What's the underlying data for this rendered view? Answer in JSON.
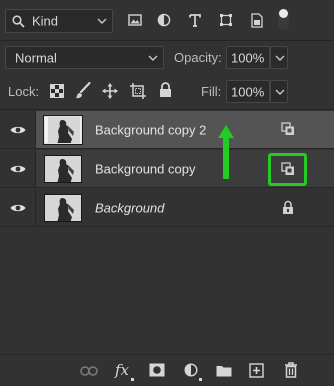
{
  "filter": {
    "kind_label": "Kind"
  },
  "filter_icons": [
    "image-filter-icon",
    "adjustment-filter-icon",
    "type-filter-icon",
    "shape-filter-icon",
    "smart-object-filter-icon",
    "filter-toggle-icon"
  ],
  "blend": {
    "mode": "Normal",
    "opacity_label": "Opacity:",
    "opacity_value": "100%"
  },
  "lock": {
    "label": "Lock:",
    "fill_label": "Fill:",
    "fill_value": "100%"
  },
  "layers": [
    {
      "name": "Background copy 2",
      "italic": false,
      "selected": true,
      "badge": "smart-object-icon"
    },
    {
      "name": "Background copy",
      "italic": false,
      "selected": false,
      "badge": "smart-object-icon",
      "highlighted": true
    },
    {
      "name": "Background",
      "italic": true,
      "selected": false,
      "badge": "lock-icon"
    }
  ],
  "annotation": {
    "color": "#22cc22"
  },
  "bottom_icons": [
    "link-layers-icon",
    "fx-icon",
    "add-mask-icon",
    "adjustment-layer-icon",
    "new-group-icon",
    "new-layer-icon",
    "delete-layer-icon"
  ],
  "bottom_fx_label": "fx"
}
